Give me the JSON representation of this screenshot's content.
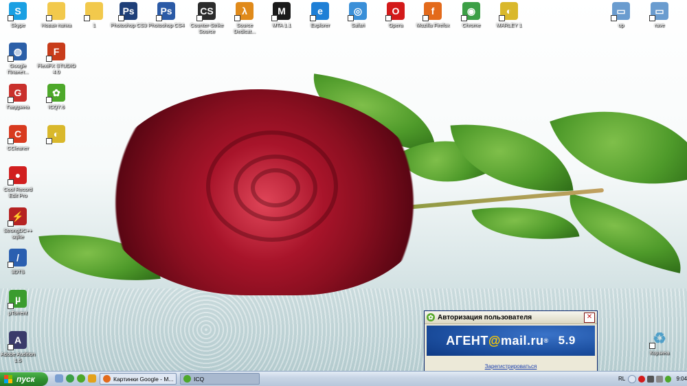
{
  "desktop": {
    "icons_top_row": [
      {
        "label": "Skype",
        "icon": "skype-icon",
        "color": "#1aa0e3",
        "glyph": "S"
      },
      {
        "label": "Новая папка",
        "icon": "folder-icon",
        "color": "#f2c94c",
        "glyph": ""
      },
      {
        "label": "1",
        "icon": "folder-icon",
        "color": "#f2c94c",
        "glyph": ""
      },
      {
        "label": "Photoshop CS3",
        "icon": "photoshop-icon",
        "color": "#1f3f78",
        "glyph": "Ps"
      },
      {
        "label": "Photoshop CS4",
        "icon": "photoshop-icon",
        "color": "#2b5aa6",
        "glyph": "Ps"
      },
      {
        "label": "Counter-Strike Source",
        "icon": "counter-strike-icon",
        "color": "#2c2c2c",
        "glyph": "CS"
      },
      {
        "label": "Source Dedicat...",
        "icon": "half-life-icon",
        "color": "#e08a1a",
        "glyph": "λ"
      },
      {
        "label": "MTA 1.1",
        "icon": "mta-icon",
        "color": "#1a1a1a",
        "glyph": "M"
      },
      {
        "label": "Explorer",
        "icon": "internet-explorer-icon",
        "color": "#1e7fd6",
        "glyph": "e"
      },
      {
        "label": "Safari",
        "icon": "safari-icon",
        "color": "#3a8fd8",
        "glyph": "◎"
      },
      {
        "label": "Opera",
        "icon": "opera-icon",
        "color": "#d31a1a",
        "glyph": "O"
      },
      {
        "label": "Mozilla Firefox",
        "icon": "firefox-icon",
        "color": "#e36a1b",
        "glyph": "f"
      },
      {
        "label": "Chrome",
        "icon": "chrome-icon",
        "color": "#3c9f46",
        "glyph": "◉"
      },
      {
        "label": "MARLEY 1",
        "icon": "cd-icon",
        "color": "#d9b82b",
        "glyph": "◐"
      }
    ],
    "icons_right": [
      {
        "label": "up",
        "icon": "network-drive-icon",
        "color": "#6a9ccf",
        "glyph": "▭"
      },
      {
        "label": "rave",
        "icon": "network-drive-icon",
        "color": "#6a9ccf",
        "glyph": "▭"
      }
    ],
    "icons_left_column": [
      {
        "label": "Google Планет...",
        "icon": "google-earth-icon",
        "color": "#2b5fa8",
        "glyph": "◍"
      },
      {
        "label": "Гавдрина",
        "icon": "gavdrina-icon",
        "color": "#c9302c",
        "glyph": "G"
      },
      {
        "label": "CCleaner",
        "icon": "ccleaner-icon",
        "color": "#d83a1f",
        "glyph": "C"
      },
      {
        "label": "Cool Record Edit Pro",
        "icon": "cool-record-icon",
        "color": "#d11f1f",
        "glyph": "●"
      },
      {
        "label": "StrongDC++ sqlite",
        "icon": "strongdc-icon",
        "color": "#b52222",
        "glyph": "⚡"
      },
      {
        "label": "3DTS",
        "icon": "3dts-icon",
        "color": "#2a5fb0",
        "glyph": "/"
      },
      {
        "label": "µTorrent",
        "icon": "utorrent-icon",
        "color": "#3b9c2e",
        "glyph": "µ"
      },
      {
        "label": "Adobe Audition 1.5",
        "icon": "adobe-audition-icon",
        "color": "#3a3a6a",
        "glyph": "A"
      }
    ],
    "icons_second_column": [
      {
        "label": "FlexiFX STUDIO 4.0",
        "icon": "flexifx-icon",
        "color": "#c83c1a",
        "glyph": "F"
      },
      {
        "label": "ICQ7.6",
        "icon": "icq-icon",
        "color": "#4da82a",
        "glyph": "✿"
      },
      {
        "label": "",
        "icon": "cd-icon",
        "color": "#d9b82b",
        "glyph": "◐"
      }
    ],
    "recycle_bin": {
      "label": "Корзина",
      "icon": "recycle-bin-icon",
      "color": "#6fb3d8",
      "glyph": "♻"
    }
  },
  "agent_window": {
    "title": "Авторизация пользователя",
    "brand_prefix": "АГЕНТ",
    "brand_at": "@",
    "brand_domain": "mail.ru",
    "brand_suffix": "®",
    "version": "5.9",
    "register_link": "Зарегистрироваться",
    "close_glyph": "✕"
  },
  "taskbar": {
    "start_label": "пуск",
    "tasks": [
      {
        "label": "Картинки Google - М...",
        "icon": "firefox-icon",
        "color": "#e36a1b"
      },
      {
        "label": "ICQ",
        "icon": "icq-icon",
        "color": "#4da82a"
      }
    ],
    "tray": {
      "language": "RL",
      "time": "9:04"
    }
  }
}
